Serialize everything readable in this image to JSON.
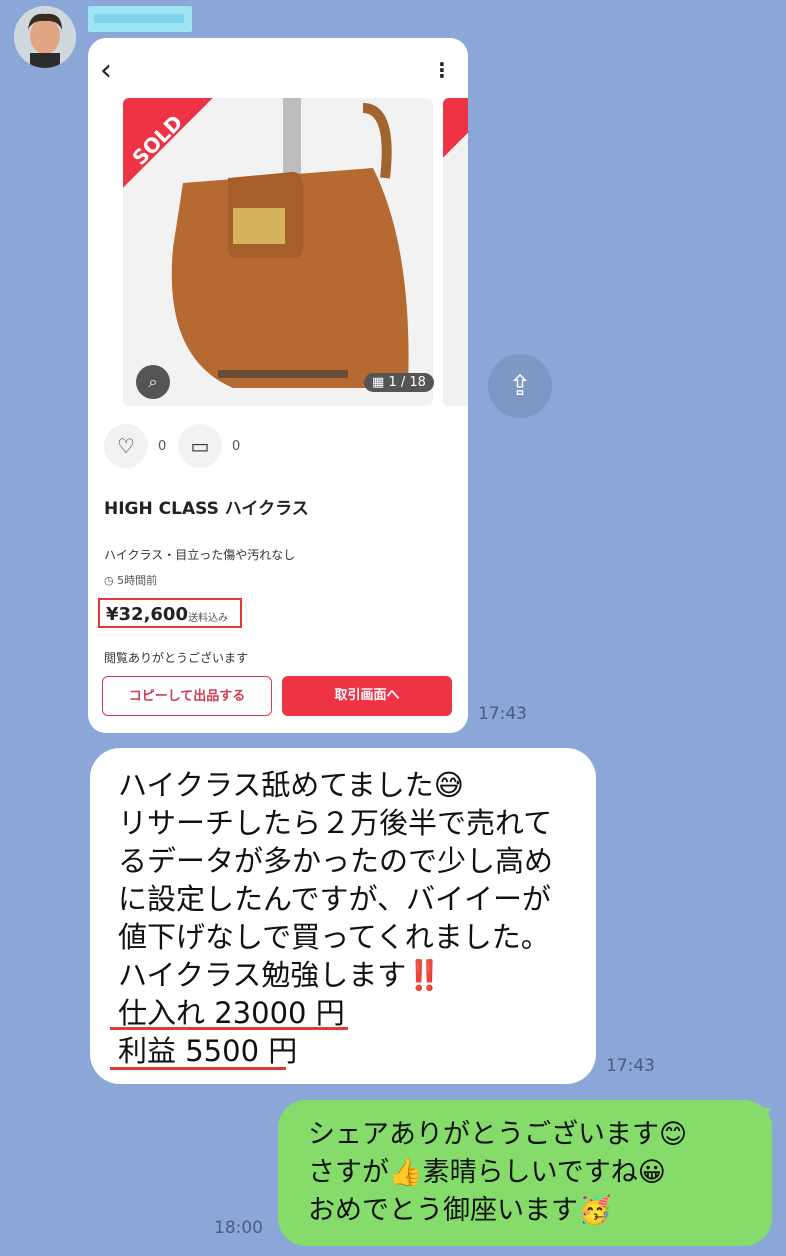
{
  "sender": {
    "name": ""
  },
  "card": {
    "badge": "SOLD",
    "image_count": "1 / 18",
    "likes": "0",
    "comments": "0",
    "title": "HIGH CLASS ハイクラス",
    "description": "ハイクラス・目立った傷や汚れなし",
    "posted": "5時間前",
    "price": "¥32,600",
    "shipping": "送料込み",
    "note": "閲覧ありがとうございます",
    "copy_button": "コピーして出品する",
    "trade_button": "取引画面へ"
  },
  "timestamps": {
    "card": "17:43",
    "message1": "17:43",
    "message2": "18:00"
  },
  "message1": {
    "text": "ハイクラス舐めてました😅\nリサーチしたら２万後半で売れて\nるデータが多かったので少し高め\nに設定したんですが、バイイーが\n値下げなしで買ってくれました。\nハイクラス勉強します‼️\n仕入れ 23000 円\n利益 5500 円"
  },
  "message2": {
    "text": "シェアありがとうございます😊\nさすが👍素晴らしいですね😀\nおめでとう御座います🥳"
  },
  "icons": [
    "avatar",
    "back-icon",
    "more-icon",
    "lens-icon",
    "grid-icon",
    "heart-icon",
    "comment-icon",
    "clock-icon",
    "share-icon"
  ]
}
